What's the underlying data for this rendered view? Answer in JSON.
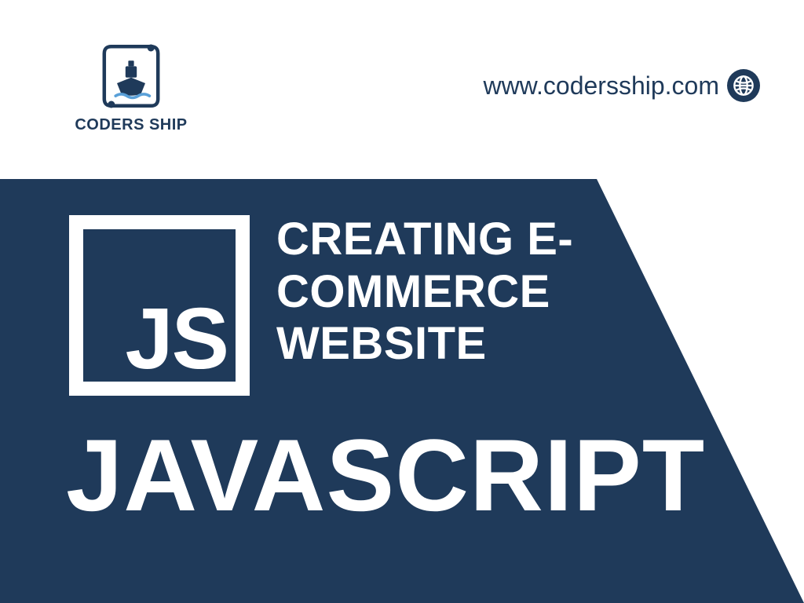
{
  "brand": {
    "name": "CODERS SHIP",
    "primary_color": "#1f3a5a",
    "accent_color": "#5aa0d8"
  },
  "header": {
    "url": "www.codersship.com"
  },
  "hero": {
    "badge_text": "JS",
    "subtitle_line1": "CREATING E-",
    "subtitle_line2": "COMMERCE",
    "subtitle_line3": "WEBSITE",
    "title": "JAVASCRIPT"
  }
}
